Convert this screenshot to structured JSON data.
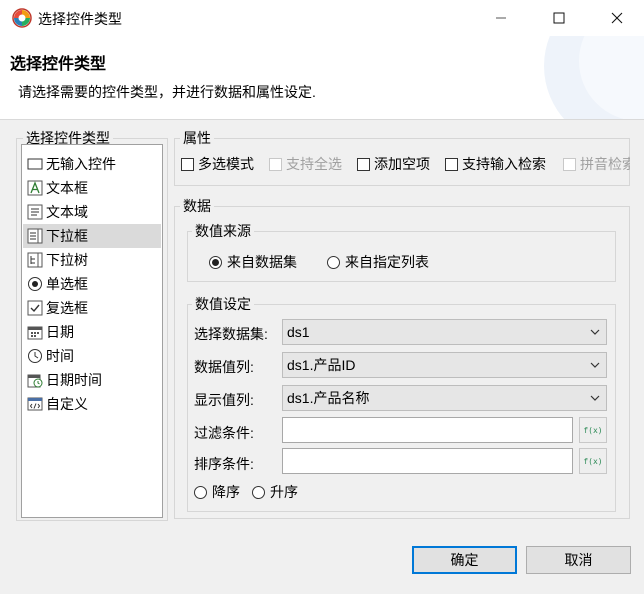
{
  "window": {
    "title": "选择控件类型",
    "header_title": "选择控件类型",
    "header_desc": "请选择需要的控件类型，并进行数据和属性设定."
  },
  "types": {
    "legend": "选择控件类型",
    "items": [
      {
        "label": "无输入控件",
        "icon": "no-input-icon"
      },
      {
        "label": "文本框",
        "icon": "textbox-icon"
      },
      {
        "label": "文本域",
        "icon": "textarea-icon"
      },
      {
        "label": "下拉框",
        "icon": "dropdown-icon",
        "selected": true
      },
      {
        "label": "下拉树",
        "icon": "dropdown-tree-icon"
      },
      {
        "label": "单选框",
        "icon": "radio-icon"
      },
      {
        "label": "复选框",
        "icon": "checkbox-icon"
      },
      {
        "label": "日期",
        "icon": "calendar-icon"
      },
      {
        "label": "时间",
        "icon": "clock-icon"
      },
      {
        "label": "日期时间",
        "icon": "datetime-icon"
      },
      {
        "label": "自定义",
        "icon": "custom-code-icon"
      }
    ]
  },
  "properties": {
    "legend": "属性",
    "multi_select": "多选模式",
    "select_all": "支持全选",
    "add_empty": "添加空项",
    "input_search": "支持输入检索",
    "pinyin_search": "拼音检索"
  },
  "data": {
    "legend": "数据",
    "source": {
      "legend": "数值来源",
      "from_dataset": "来自数据集",
      "from_list": "来自指定列表",
      "selected": "from_dataset"
    },
    "settings": {
      "legend": "数值设定",
      "dataset_label": "选择数据集:",
      "dataset_value": "ds1",
      "value_col_label": "数据值列:",
      "value_col_value": "ds1.产品ID",
      "display_col_label": "显示值列:",
      "display_col_value": "ds1.产品名称",
      "filter_label": "过滤条件:",
      "filter_value": "",
      "sort_label": "排序条件:",
      "sort_value": "",
      "fx_label": "f(x)",
      "desc": "降序",
      "asc": "升序"
    }
  },
  "buttons": {
    "ok": "确定",
    "cancel": "取消"
  }
}
